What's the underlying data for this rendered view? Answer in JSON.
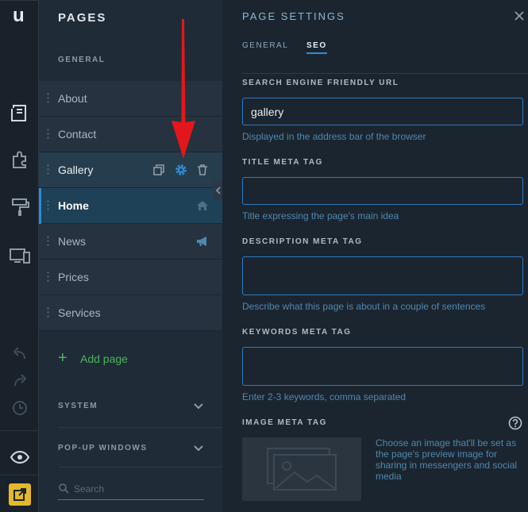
{
  "rail": {
    "logo": "u",
    "icons": [
      "pages-icon",
      "plugins-icon",
      "design-icon",
      "devices-icon",
      "undo-icon",
      "redo-icon",
      "history-icon",
      "preview-icon",
      "publish-icon"
    ]
  },
  "pages_panel": {
    "title": "PAGES",
    "general_label": "GENERAL",
    "items": [
      {
        "label": "About"
      },
      {
        "label": "Contact"
      },
      {
        "label": "Gallery"
      },
      {
        "label": "Home"
      },
      {
        "label": "News"
      },
      {
        "label": "Prices"
      },
      {
        "label": "Services"
      }
    ],
    "add_page_label": "Add page",
    "system_label": "SYSTEM",
    "popup_label": "POP-UP WINDOWS",
    "search_placeholder": "Search"
  },
  "settings": {
    "title": "PAGE SETTINGS",
    "tabs": {
      "general": "GENERAL",
      "seo": "SEO"
    },
    "url_label": "SEARCH ENGINE FRIENDLY URL",
    "url_value": "gallery",
    "url_hint": "Displayed in the address bar of the browser",
    "title_label": "TITLE META TAG",
    "title_value": "",
    "title_hint": "Title expressing the page's main idea",
    "desc_label": "DESCRIPTION META TAG",
    "desc_value": "",
    "desc_hint": "Describe what this page is about in a couple of sentences",
    "keywords_label": "KEYWORDS META TAG",
    "keywords_value": "",
    "keywords_hint": "Enter 2-3 keywords, comma separated",
    "image_label": "IMAGE META TAG",
    "image_hint": "Choose an image that'll be set as the page's preview image for sharing in messengers and social media"
  },
  "colors": {
    "accent": "#2f8bd6",
    "add": "#4cb35c",
    "arrow": "#e3171b",
    "publish": "#e3b82b"
  }
}
